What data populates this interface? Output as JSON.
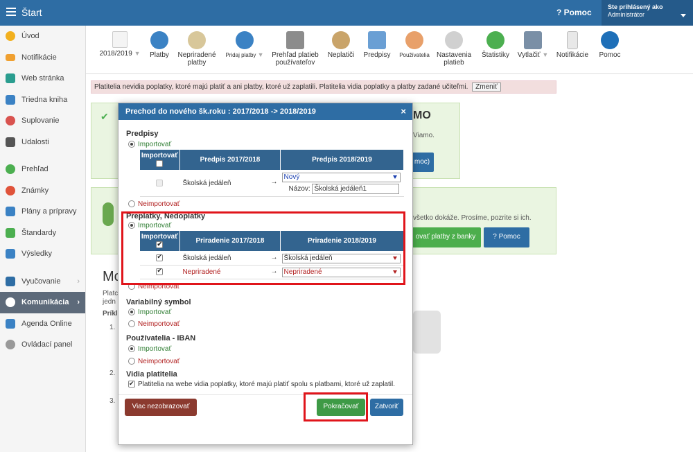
{
  "topbar": {
    "home_label": "Štart",
    "help_label": "Pomoc",
    "user_line1": "Ste prihlásený ako",
    "user_line2": "Administrátor"
  },
  "sidebar": {
    "items": [
      {
        "label": "Úvod"
      },
      {
        "label": "Notifikácie"
      },
      {
        "label": "Web stránka"
      },
      {
        "label": "Triedna kniha"
      },
      {
        "label": "Suplovanie"
      },
      {
        "label": "Udalosti"
      },
      {
        "label": "Prehľad"
      },
      {
        "label": "Známky"
      },
      {
        "label": "Plány a prípravy"
      },
      {
        "label": "Štandardy"
      },
      {
        "label": "Výsledky"
      },
      {
        "label": "Vyučovanie"
      },
      {
        "label": "Komunikácia"
      },
      {
        "label": "Agenda Online"
      },
      {
        "label": "Ovládací panel"
      }
    ]
  },
  "toolbar": {
    "year": "2018/2019",
    "items": [
      {
        "label": "Platby"
      },
      {
        "label": "Nepriradené platby"
      },
      {
        "label": "Pridaj platby"
      },
      {
        "label": "Prehľad platieb používateľov"
      },
      {
        "label": "Neplatiči"
      },
      {
        "label": "Predpisy"
      },
      {
        "label": "Používatelia"
      },
      {
        "label": "Nastavenia platieb"
      },
      {
        "label": "Štatistiky"
      },
      {
        "label": "Vytlačiť"
      },
      {
        "label": "Notifikácie"
      },
      {
        "label": "Pomoc"
      }
    ]
  },
  "alert": {
    "text": "Platitelia nevidia poplatky, ktoré majú platiť a ani platby, ktoré už zaplatili. Platitelia vidia poplatky a platby zadané učiteľmi.",
    "button": "Zmeniť"
  },
  "background": {
    "text1": "Viamo.",
    "btn_partial": "moc)",
    "text2": "všetko dokáže. Prosíme, pozrite si ich.",
    "import_btn": "ovať platby z banky",
    "help_btn": "Pomoc",
    "heading_partial": "Mo",
    "left_partial1": "Platc",
    "left_partial2": "jedn",
    "left_partial3": "Príkl",
    "n1": "1.",
    "n2": "2.",
    "n3": "3.",
    "viamo_partial": "MO"
  },
  "modal": {
    "title": "Prechod do nového šk.roku : 2017/2018 -> 2018/2019",
    "close": "×",
    "predpisy": {
      "heading": "Predpisy",
      "import": "Importovať",
      "no_import": "Neimportovať",
      "col_import": "Importovať",
      "col_from": "Predpis 2017/2018",
      "col_to": "Predpis 2018/2019",
      "row_name": "Školská jedáleň",
      "arrow": "→",
      "select_value": "Nový",
      "name_label": "Názov:",
      "name_value": "Školská jedáleň1"
    },
    "preplatky": {
      "heading": "Preplatky, Nedoplatky",
      "import": "Importovať",
      "no_import": "Neimportovať",
      "col_import": "Importovať",
      "col_from": "Priradenie 2017/2018",
      "col_to": "Priradenie 2018/2019",
      "rows": [
        {
          "from": "Školská jedáleň",
          "to": "Školská jedáleň"
        },
        {
          "from": "Nepriradené",
          "to": "Nepriradené"
        }
      ],
      "arrow": "→"
    },
    "varsym": {
      "heading": "Variabilný symbol",
      "import": "Importovať",
      "no_import": "Neimportovať"
    },
    "iban": {
      "heading": "Používatelia - IBAN",
      "import": "Importovať",
      "no_import": "Neimportovať"
    },
    "vidia": {
      "heading": "Vidia platitelia",
      "check_label": "Platitelia na webe vidia poplatky, ktoré majú platiť spolu s platbami, ktoré už zaplatil."
    },
    "buttons": {
      "hide": "Viac nezobrazovať",
      "continue": "Pokračovať",
      "close": "Zatvoriť"
    }
  }
}
